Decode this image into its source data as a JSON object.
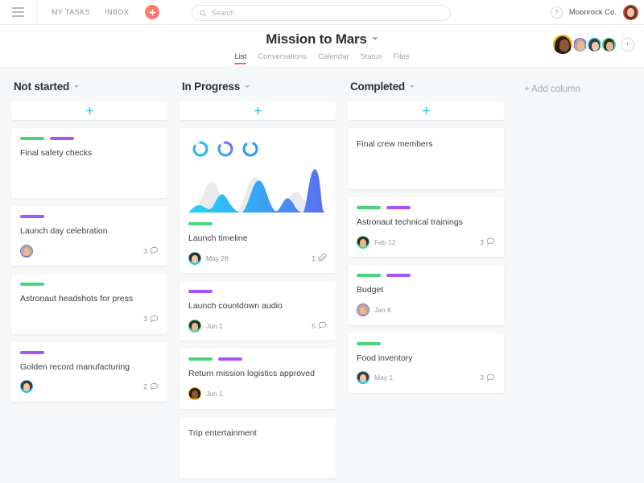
{
  "topbar": {
    "menu_icon": "hamburger-icon",
    "nav": [
      {
        "label": "MY TASKS",
        "name": "my-tasks"
      },
      {
        "label": "INBOX",
        "name": "inbox"
      }
    ],
    "create_icon": "plus-icon",
    "search": {
      "placeholder": "Search",
      "value": "",
      "icon": "search-icon"
    },
    "help_label": "?",
    "org_name": "Moonrock Co.",
    "user_avatar": "user-avatar"
  },
  "project": {
    "title": "Mission to Mars",
    "title_caret": "chevron-down-icon",
    "tabs": [
      {
        "label": "List",
        "active": true
      },
      {
        "label": "Conversations",
        "active": false
      },
      {
        "label": "Calendar",
        "active": false
      },
      {
        "label": "Status",
        "active": false
      },
      {
        "label": "Files",
        "active": false
      }
    ],
    "active_tab_color": "#fb5b5b",
    "members": [
      {
        "name": "member-1",
        "bg": "#f7b500"
      },
      {
        "name": "member-2",
        "bg": "#8b6fd4"
      },
      {
        "name": "member-3",
        "bg": "#29c0e8"
      },
      {
        "name": "member-4",
        "bg": "#3ed598"
      }
    ],
    "add_member_label": "+"
  },
  "board": {
    "add_card_icon": "plus-icon",
    "add_column_label": "+ Add column",
    "tag_colors": {
      "green": "#4cd47d",
      "purple": "#a855f7"
    },
    "columns": [
      {
        "name": "not-started",
        "title": "Not started",
        "cards": [
          {
            "title": "Final safety checks",
            "tags": [
              "green",
              "purple"
            ],
            "assignee": null,
            "due": null,
            "comments": null,
            "attachments": null
          },
          {
            "title": "Launch day celebration",
            "tags": [
              "purple"
            ],
            "assignee": "#8b6fd4",
            "due": null,
            "comments": "3",
            "attachments": null
          },
          {
            "title": "Astronaut headshots for press",
            "tags": [
              "green"
            ],
            "assignee": null,
            "due": null,
            "comments": "3",
            "attachments": null
          },
          {
            "title": "Golden record manufacturing",
            "tags": [
              "purple"
            ],
            "assignee": "#29c0e8",
            "due": null,
            "comments": "2",
            "attachments": null
          }
        ]
      },
      {
        "name": "in-progress",
        "title": "In Progress",
        "cards": [
          {
            "title": "Launch timeline",
            "tags": [
              "green"
            ],
            "assignee": "#29c0e8",
            "due": "May 28",
            "comments": null,
            "attachments": "1",
            "has_chart": true
          },
          {
            "title": "Launch countdown audio",
            "tags": [
              "purple"
            ],
            "assignee": "#3ed598",
            "due": "Jun 1",
            "comments": "5",
            "attachments": null
          },
          {
            "title": "Return mission logistics approved",
            "tags": [
              "green",
              "purple"
            ],
            "assignee": "#f7b500",
            "due": "Jun 1",
            "comments": null,
            "attachments": null
          },
          {
            "title": "Trip entertainment",
            "tags": [],
            "assignee": null,
            "due": null,
            "comments": null,
            "attachments": null
          }
        ]
      },
      {
        "name": "completed",
        "title": "Completed",
        "cards": [
          {
            "title": "Final crew members",
            "tags": [],
            "assignee": null,
            "due": null,
            "comments": null,
            "attachments": null
          },
          {
            "title": "Astronaut technical trainings",
            "tags": [
              "green",
              "purple"
            ],
            "assignee": "#3ed598",
            "due": "Feb 12",
            "comments": "3",
            "attachments": null
          },
          {
            "title": "Budget",
            "tags": [
              "green",
              "purple"
            ],
            "assignee": "#8b6fd4",
            "due": "Jan 6",
            "comments": null,
            "attachments": null
          },
          {
            "title": "Food inventory",
            "tags": [
              "green"
            ],
            "assignee": "#29c0e8",
            "due": "May 1",
            "comments": "3",
            "attachments": null
          }
        ]
      }
    ]
  },
  "chart_data": {
    "type": "area",
    "title": "Launch timeline",
    "xlabel": "",
    "ylabel": "",
    "x": [
      0,
      1,
      2,
      3,
      4,
      5,
      6,
      7,
      8,
      9,
      10,
      11,
      12,
      13,
      14,
      15,
      16
    ],
    "series": [
      {
        "name": "background",
        "color": "#e8eaec",
        "values": [
          0,
          5,
          48,
          10,
          8,
          60,
          12,
          6,
          30,
          8,
          5,
          40,
          10,
          4,
          3,
          2,
          0
        ]
      },
      {
        "name": "foreground",
        "color_start": "#28d3f5",
        "color_end": "#5b6ef0",
        "values": [
          2,
          18,
          6,
          34,
          7,
          5,
          62,
          14,
          30,
          10,
          25,
          6,
          4,
          90,
          70,
          8,
          2
        ]
      }
    ],
    "ylim": [
      0,
      100
    ],
    "grid": false,
    "legend": "none",
    "rings": [
      {
        "name": "ring-1",
        "value": 82,
        "color": "#2bb8f0"
      },
      {
        "name": "ring-2",
        "value": 85,
        "color": "#7b6bf0"
      },
      {
        "name": "ring-3",
        "value": 80,
        "color": "#2b9cf0"
      }
    ]
  }
}
